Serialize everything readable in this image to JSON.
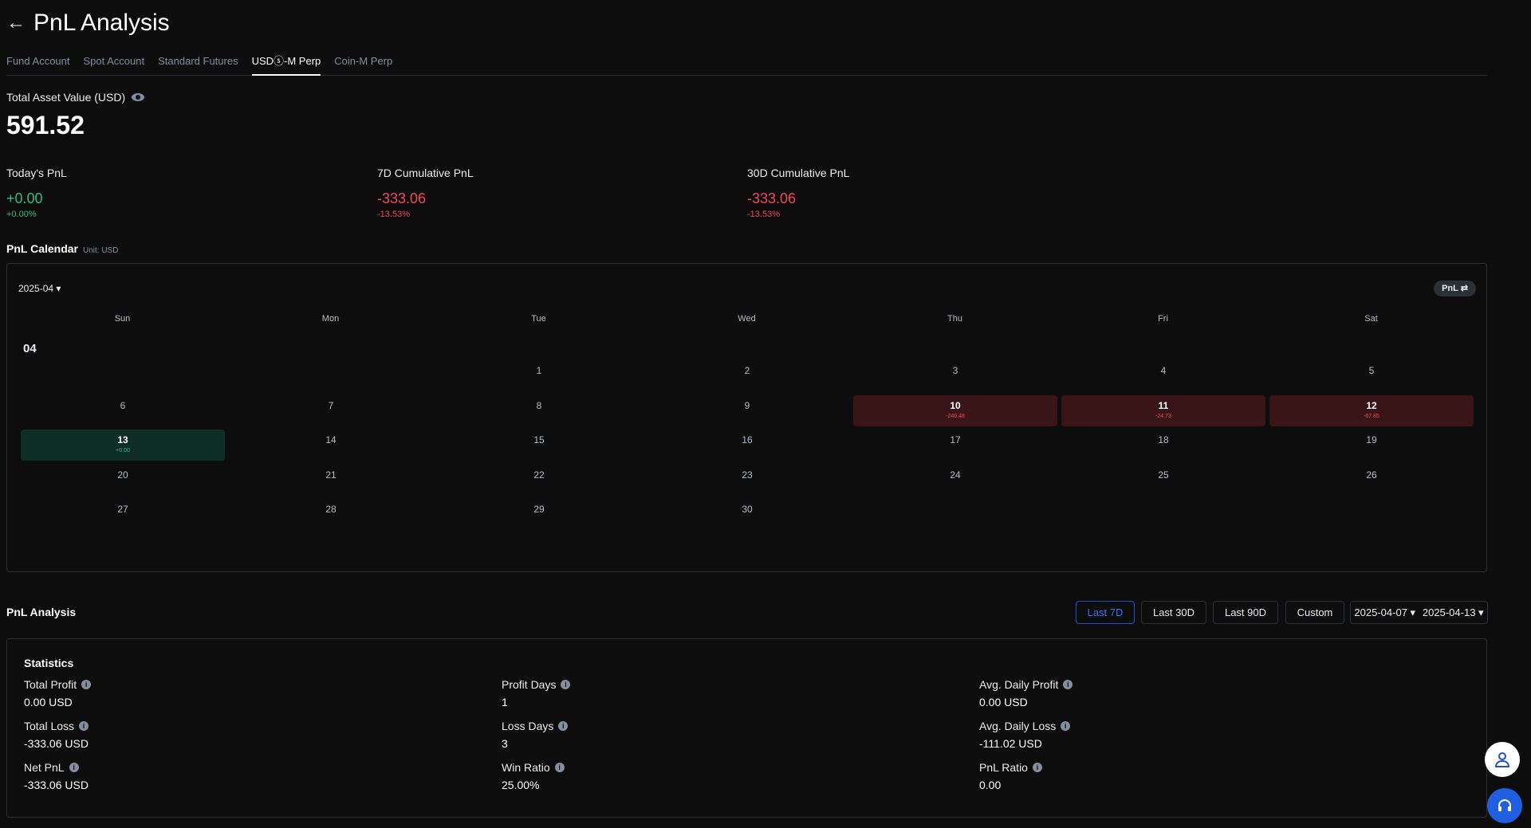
{
  "header": {
    "title": "PnL Analysis",
    "back_icon": "←"
  },
  "tabs": [
    "Fund Account",
    "Spot Account",
    "Standard Futures",
    "USDⓢ-M Perp",
    "Coin-M Perp"
  ],
  "asset": {
    "label": "Total Asset Value (USD)",
    "value": "591.52"
  },
  "pnl": [
    {
      "label": "Today's PnL",
      "value": "+0.00",
      "pct": "+0.00%"
    },
    {
      "label": "7D Cumulative PnL",
      "value": "-333.06",
      "pct": "-13.53%"
    },
    {
      "label": "30D Cumulative PnL",
      "value": "-333.06",
      "pct": "-13.53%"
    }
  ],
  "calendar": {
    "title": "PnL Calendar",
    "unit": "Unit: USD",
    "month": "2025-04 ▾",
    "toggle": "PnL ⇄",
    "month_label": "04",
    "weekdays": [
      "Sun",
      "Mon",
      "Tue",
      "Wed",
      "Thu",
      "Fri",
      "Sat"
    ],
    "first_weekday": 2,
    "days": 30,
    "pnl": {
      "10": "-240.48",
      "11": "-24.73",
      "12": "-67.85",
      "13": "+0.00"
    }
  },
  "analysis": {
    "title": "PnL Analysis",
    "ranges": [
      "Last 7D",
      "Last 30D",
      "Last 90D",
      "Custom"
    ],
    "active": "Last 7D",
    "start": "2025-04-07 ▾",
    "end": "2025-04-13 ▾"
  },
  "stats": {
    "title": "Statistics",
    "items": [
      {
        "label": "Total Profit",
        "value": "0.00 USD"
      },
      {
        "label": "Profit Days",
        "value": "1"
      },
      {
        "label": "Avg. Daily Profit",
        "value": "0.00 USD"
      },
      {
        "label": "Total Loss",
        "value": "-333.06 USD"
      },
      {
        "label": "Loss Days",
        "value": "3"
      },
      {
        "label": "Avg. Daily Loss",
        "value": "-111.02 USD"
      },
      {
        "label": "Net PnL",
        "value": "-333.06 USD"
      },
      {
        "label": "Win Ratio",
        "value": "25.00%"
      },
      {
        "label": "PnL Ratio",
        "value": "0.00"
      }
    ]
  }
}
